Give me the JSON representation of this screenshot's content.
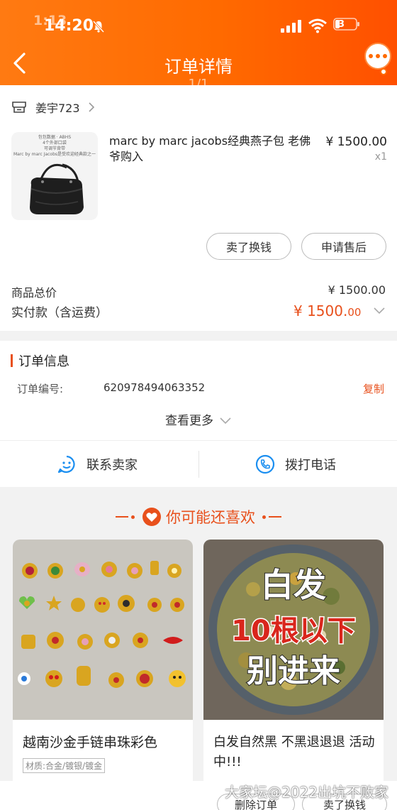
{
  "status_bar": {
    "time": "14:20",
    "time_ghost": "1:13",
    "battery": "3"
  },
  "header": {
    "title": "订单详情",
    "subtitle": "1/1"
  },
  "shop": {
    "name": "姜宇723"
  },
  "product": {
    "title": "marc by marc jacobs经典燕子包 老佛爷购入",
    "price": "¥ 1500.00",
    "qty": "x1",
    "thumb_lines": [
      "包包数据 · ABHS",
      "4个外部口袋",
      "可调节背带",
      "Marc by marc Jacobs是受欢迎经典款之一"
    ]
  },
  "actions": {
    "sell": "卖了换钱",
    "after_sale": "申请售后"
  },
  "totals": {
    "goods_total_label": "商品总价",
    "goods_total_value": "¥ 1500.00",
    "paid_label": "实付款（含运费）",
    "paid_main": "¥ 1500.",
    "paid_cents": "00"
  },
  "order_info": {
    "title": "订单信息",
    "order_no_label": "订单编号:",
    "order_no_value": "620978494063352",
    "copy": "复制",
    "see_more": "查看更多"
  },
  "contact": {
    "seller": "联系卖家",
    "call": "拨打电话"
  },
  "recommend": {
    "title": "你可能还喜欢",
    "items": [
      {
        "name": "越南沙金手链串珠彩色",
        "tag": "材质:合金/镀银/镀金",
        "button": "删除订单"
      },
      {
        "name": "白发自然黑 不黑退退退 活动中!!!",
        "overlay_top": "白发",
        "overlay_mid": "10根以下",
        "overlay_bottom": "别进来",
        "button": "卖了换钱"
      }
    ]
  },
  "watermark": "大家坛@2022出坑不败家",
  "colors": {
    "brand_orange": "#ff6a00",
    "accent_red": "#e8501c"
  }
}
